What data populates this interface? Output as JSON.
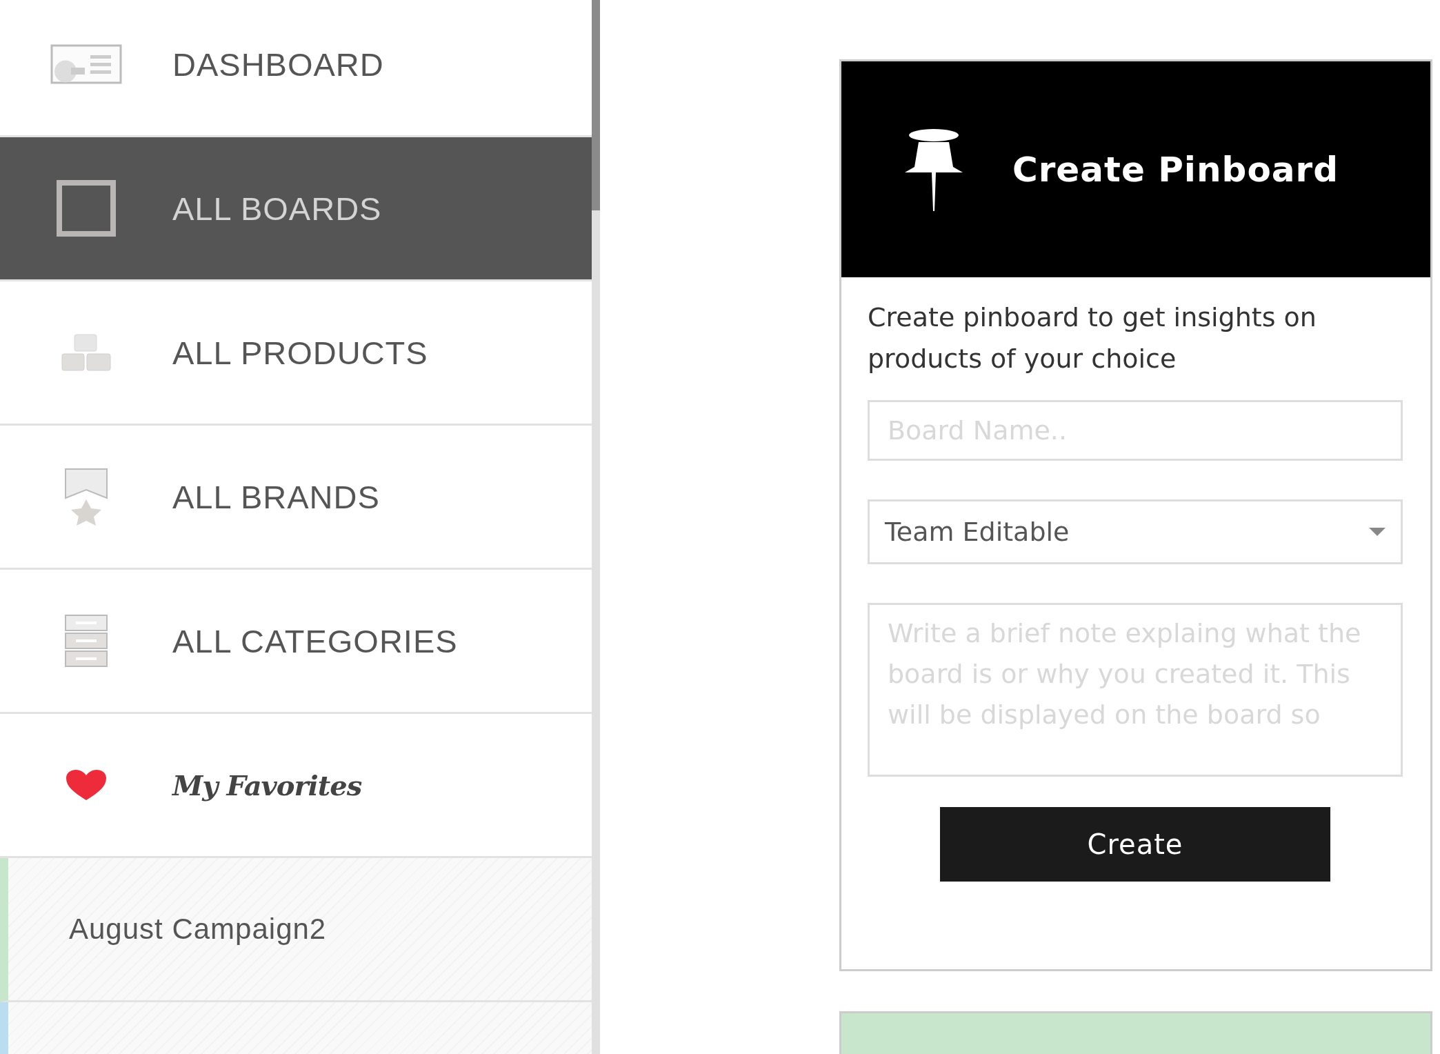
{
  "sidebar": {
    "items": [
      {
        "kind": "nav",
        "label": "DASHBOARD",
        "selected": false
      },
      {
        "kind": "nav",
        "label": "ALL BOARDS",
        "selected": true
      },
      {
        "kind": "nav",
        "label": "ALL PRODUCTS",
        "selected": false
      },
      {
        "kind": "nav",
        "label": "ALL BRANDS",
        "selected": false
      },
      {
        "kind": "nav",
        "label": "ALL CATEGORIES",
        "selected": false
      },
      {
        "kind": "favorites",
        "label": "My Favorites",
        "selected": false
      },
      {
        "kind": "board",
        "label": "August Campaign2",
        "color": "#c8e6cc"
      },
      {
        "kind": "board",
        "color": "#bcdcf2"
      }
    ]
  },
  "panel": {
    "title": "Create Pinboard",
    "description": "Create pinboard to get insights on products of your choice",
    "name_field": {
      "placeholder": "Board Name.."
    },
    "access_select": {
      "value": "Team Editable"
    },
    "note_field": {
      "placeholder": "Write a brief note explaing what the board is or why you created it. This will be displayed on the board so"
    },
    "button": "Create"
  },
  "next_card": {
    "color": "#c8e6cc"
  }
}
